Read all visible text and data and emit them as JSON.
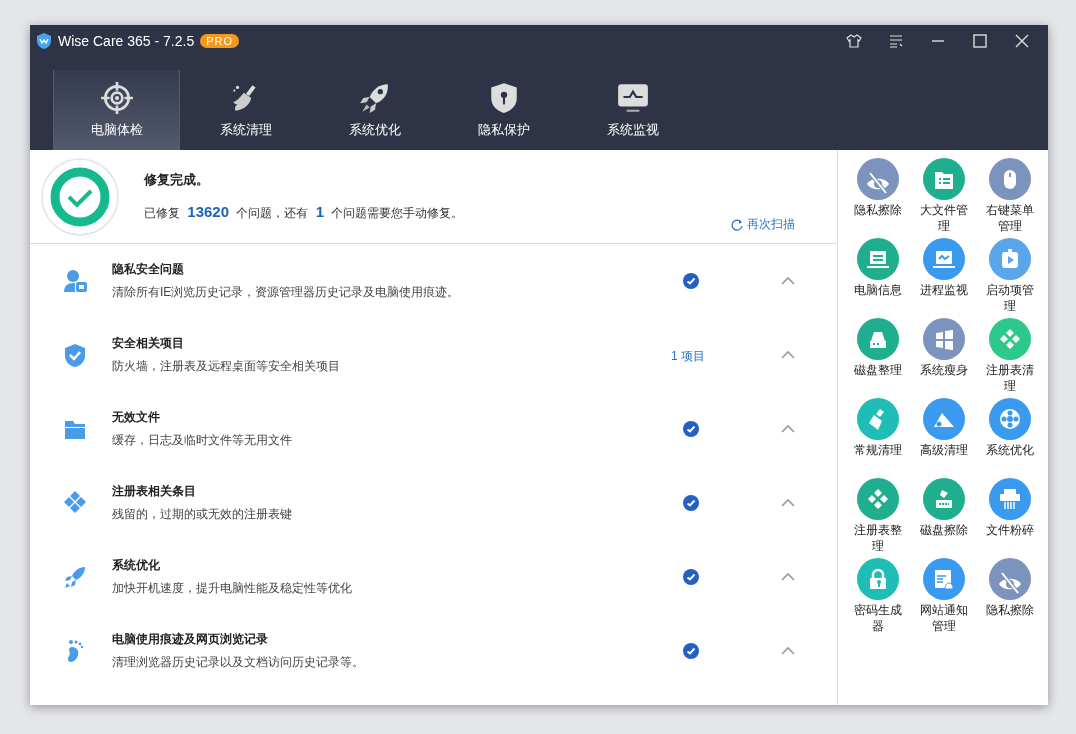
{
  "window": {
    "title": "Wise Care 365 - 7.2.5",
    "badge": "PRO"
  },
  "tabs": [
    {
      "label": "电脑体检",
      "kind": "target",
      "selected": true
    },
    {
      "label": "系统清理",
      "kind": "broom",
      "selected": false
    },
    {
      "label": "系统优化",
      "kind": "rocket",
      "selected": false
    },
    {
      "label": "隐私保护",
      "kind": "shield",
      "selected": false
    },
    {
      "label": "系统监视",
      "kind": "monitor",
      "selected": false
    }
  ],
  "summary": {
    "title": "修复完成。",
    "detail": "已修复 **13620** 个问题，还有 **1** 个问题需要您手动修复。",
    "rescan": "再次扫描"
  },
  "items": [
    {
      "kind": "privacy",
      "title": "隐私安全问题",
      "description": "清除所有IE浏览历史记录，资源管理器历史记录及电脑使用痕迹。",
      "fixed": true
    },
    {
      "kind": "security",
      "title": "安全相关项目",
      "description": "防火墙，注册表及远程桌面等安全相关项目",
      "fixed": false,
      "count": "1 项目"
    },
    {
      "kind": "files",
      "title": "无效文件",
      "description": "缓存，日志及临时文件等无用文件",
      "fixed": true
    },
    {
      "kind": "registry",
      "title": "注册表相关条目",
      "description": "残留的，过期的或无效的注册表键",
      "fixed": true
    },
    {
      "kind": "optimize",
      "title": "系统优化",
      "description": "加快开机速度，提升电脑性能及稳定性等优化",
      "fixed": true
    },
    {
      "kind": "traces",
      "title": "电脑使用痕迹及网页浏览记录",
      "description": "清理浏览器历史记录以及文档访问历史记录等。",
      "fixed": true
    }
  ],
  "tools": [
    {
      "label": "隐私擦除",
      "kind": "eye-off",
      "color": "#7b93bd"
    },
    {
      "label": "大文件管理",
      "kind": "list-file",
      "color": "#1fae8e"
    },
    {
      "label": "右键菜单管理",
      "kind": "mouse",
      "color": "#7b93bd"
    },
    {
      "label": "电脑信息",
      "kind": "laptop",
      "color": "#1fae8e"
    },
    {
      "label": "进程监视",
      "kind": "wave-laptop",
      "color": "#3a9af0"
    },
    {
      "label": "启动项管理",
      "kind": "play",
      "color": "#5aa6ea"
    },
    {
      "label": "磁盘整理",
      "kind": "disk",
      "color": "#1fae8e"
    },
    {
      "label": "系统瘦身",
      "kind": "windows",
      "color": "#7b93bd"
    },
    {
      "label": "注册表清理",
      "kind": "diamonds",
      "color": "#2dc98a"
    },
    {
      "label": "常规清理",
      "kind": "brush",
      "color": "#1ebdb5"
    },
    {
      "label": "高级清理",
      "kind": "vacuum",
      "color": "#3a9af0"
    },
    {
      "label": "系统优化",
      "kind": "gear",
      "color": "#3a9af0"
    },
    {
      "label": "注册表整理",
      "kind": "diamonds",
      "color": "#1fae8e"
    },
    {
      "label": "磁盘擦除",
      "kind": "disk-erase",
      "color": "#1fae8e"
    },
    {
      "label": "文件粉碎",
      "kind": "shredder",
      "color": "#3a9af0"
    },
    {
      "label": "密码生成器",
      "kind": "lock",
      "color": "#1ebdb5"
    },
    {
      "label": "网站通知管理",
      "kind": "browser-bell",
      "color": "#3a9af0"
    },
    {
      "label": "隐私擦除",
      "kind": "eye-off",
      "color": "#7b93bd"
    }
  ]
}
